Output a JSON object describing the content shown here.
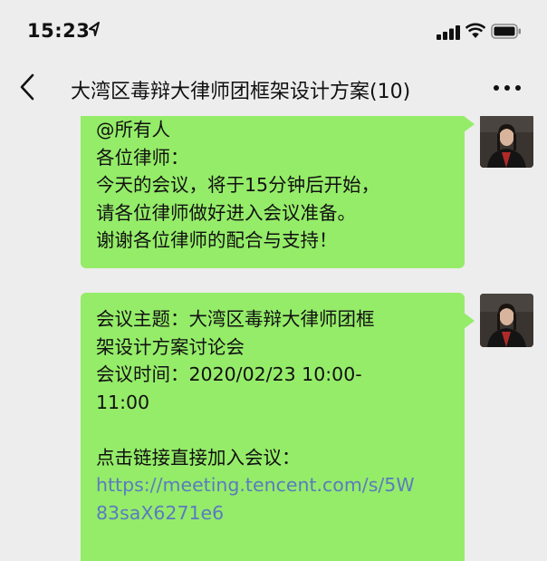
{
  "status_bar": {
    "time": "15:23"
  },
  "nav": {
    "title": "大湾区毒辩大律师团框架设计方案(10)"
  },
  "messages": [
    {
      "lines": [
        "@所有人",
        "各位律师：",
        "今天的会议，将于15分钟后开始，",
        "请各位律师做好进入会议准备。",
        "谢谢各位律师的配合与支持！"
      ]
    },
    {
      "lines": [
        "会议主题：大湾区毒辩大律师团框",
        "架设计方案讨论会",
        "会议时间：2020/02/23 10:00-",
        "11:00",
        "",
        "点击链接直接加入会议："
      ],
      "link_lines": [
        "https://meeting.tencent.com/s/5W",
        "83saX6271e6"
      ]
    }
  ],
  "colors": {
    "background": "#ededed",
    "bubble": "#95ec69",
    "link": "#5b7bbf"
  }
}
